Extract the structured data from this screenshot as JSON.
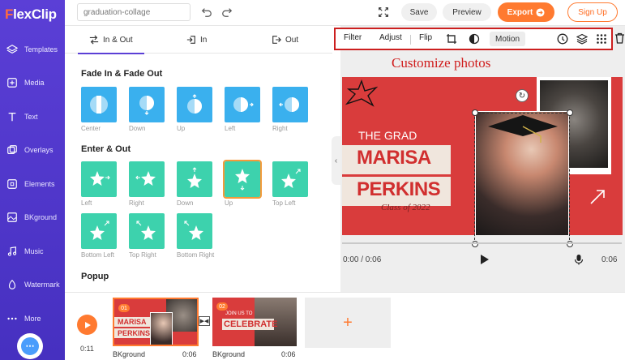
{
  "app": {
    "logo_f": "F",
    "logo_rest": "lexClip"
  },
  "sidebar": {
    "items": [
      {
        "label": "Templates",
        "icon": "layers-icon"
      },
      {
        "label": "Media",
        "icon": "media-icon"
      },
      {
        "label": "Text",
        "icon": "text-icon"
      },
      {
        "label": "Overlays",
        "icon": "overlays-icon"
      },
      {
        "label": "Elements",
        "icon": "elements-icon"
      },
      {
        "label": "BKground",
        "icon": "background-icon"
      },
      {
        "label": "Music",
        "icon": "music-icon"
      },
      {
        "label": "Watermark",
        "icon": "watermark-icon"
      },
      {
        "label": "More",
        "icon": "more-icon"
      }
    ]
  },
  "topbar": {
    "project_name": "graduation-collage",
    "save_label": "Save",
    "preview_label": "Preview",
    "export_label": "Export",
    "signup_label": "Sign Up"
  },
  "panel": {
    "tabs": [
      {
        "label": "In & Out",
        "active": true
      },
      {
        "label": "In",
        "active": false
      },
      {
        "label": "Out",
        "active": false
      }
    ],
    "fade_title": "Fade In & Fade Out",
    "fade_items": [
      "Center",
      "Down",
      "Up",
      "Left",
      "Right"
    ],
    "enter_title": "Enter & Out",
    "enter_items": [
      "Left",
      "Right",
      "Down",
      "Up",
      "Top Left",
      "Bottom Left",
      "Top Right",
      "Bottom Right"
    ],
    "selected_item": "Up",
    "popup_title": "Popup"
  },
  "photo_toolbar": {
    "filter": "Filter",
    "adjust": "Adjust",
    "flip": "Flip",
    "motion": "Motion"
  },
  "annotation": "Customize photos",
  "canvas": {
    "grad_line": "THE GRAD",
    "first_name": "MARISA",
    "last_name": "PERKINS",
    "script": "Class of 2022"
  },
  "player": {
    "current": "0:00 / 0:06",
    "total": "0:06"
  },
  "timeline": {
    "time": "0:11",
    "clips": [
      {
        "num": "01",
        "label": "BKground",
        "duration": "0:06",
        "title1": "MARISA",
        "title2": "PERKINS"
      },
      {
        "num": "02",
        "label": "BKground",
        "duration": "0:06",
        "small": "JOIN US TO",
        "title": "CELEBRATE"
      }
    ],
    "add_symbol": "+"
  },
  "colors": {
    "sidebar": "#5b3fd6",
    "accent": "#ff7a30",
    "canvas_red": "#d93c3c",
    "annotation_red": "#d01d1d"
  }
}
